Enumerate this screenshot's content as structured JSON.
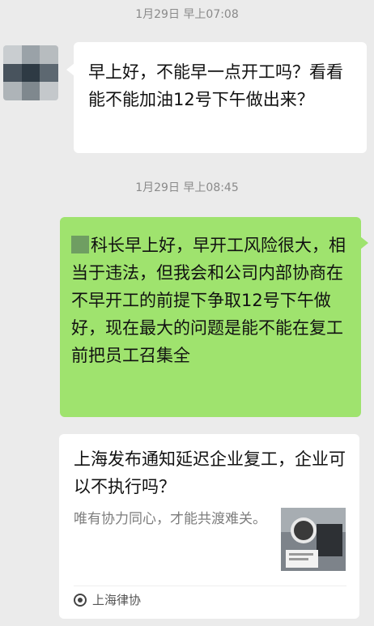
{
  "chat": {
    "messages": [
      {
        "time": "1月29日 早上07:08",
        "text": "早上好，不能早一点开工吗？看看能不能加油12号下午做出来？"
      },
      {
        "time": "1月29日 早上08:45",
        "text": "科长早上好，早开工风险很大，相当于违法，但我会和公司内部协商在不早开工的前提下争取12号下午做好，现在最大的问题是能不能在复工前把员工召集全"
      }
    ],
    "card": {
      "title": "上海发布通知延迟企业复工，企业可以不执行吗？",
      "desc": "唯有协力同心，才能共渡难关。",
      "source": "上海律协",
      "thumb_icon": "article-thumbnail-image",
      "source_icon": "official-account-icon"
    }
  },
  "colors": {
    "outgoing_bubble": "#9fe36e",
    "incoming_bubble": "#ffffff",
    "background": "#ebebeb"
  }
}
